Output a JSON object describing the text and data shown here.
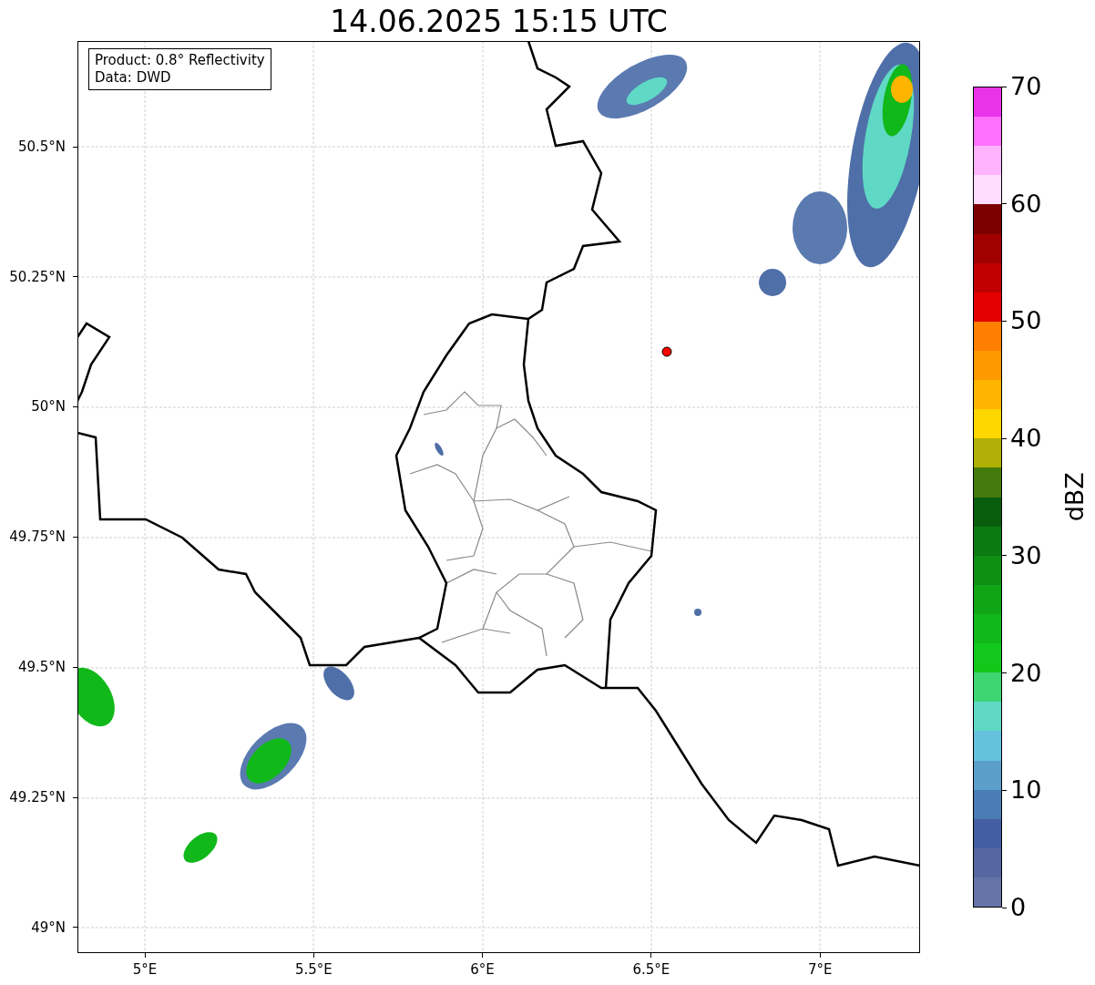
{
  "title": "14.06.2025 15:15 UTC",
  "legend": [
    "Product: 0.8° Reflectivity",
    "Data: DWD"
  ],
  "y_ticks": [
    "50.5°N",
    "50.25°N",
    "50°N",
    "49.75°N",
    "49.5°N",
    "49.25°N",
    "49°N"
  ],
  "x_ticks": [
    "5°E",
    "5.5°E",
    "6°E",
    "6.5°E",
    "7°E"
  ],
  "colorbar": {
    "label": "dBZ",
    "ticks": [
      "70",
      "60",
      "50",
      "40",
      "30",
      "20",
      "10",
      "0"
    ],
    "segments": [
      {
        "color": "#e833e8"
      },
      {
        "color": "#ff70ff"
      },
      {
        "color": "#ffb3ff"
      },
      {
        "color": "#ffdcff"
      },
      {
        "color": "#7b0000"
      },
      {
        "color": "#a00000"
      },
      {
        "color": "#c00000"
      },
      {
        "color": "#e30000"
      },
      {
        "color": "#ff7f00"
      },
      {
        "color": "#ff9900"
      },
      {
        "color": "#ffb400"
      },
      {
        "color": "#ffd700"
      },
      {
        "color": "#b0b007"
      },
      {
        "color": "#457a0c"
      },
      {
        "color": "#085e0c"
      },
      {
        "color": "#0b7a11"
      },
      {
        "color": "#0d8f13"
      },
      {
        "color": "#0fa514"
      },
      {
        "color": "#10b81a"
      },
      {
        "color": "#12c81b"
      },
      {
        "color": "#3dd672"
      },
      {
        "color": "#5fd9c5"
      },
      {
        "color": "#64c2dc"
      },
      {
        "color": "#5a9ec9"
      },
      {
        "color": "#4a7db5"
      },
      {
        "color": "#445ea3"
      },
      {
        "color": "#5566a0"
      },
      {
        "color": "#6673a6"
      }
    ]
  }
}
